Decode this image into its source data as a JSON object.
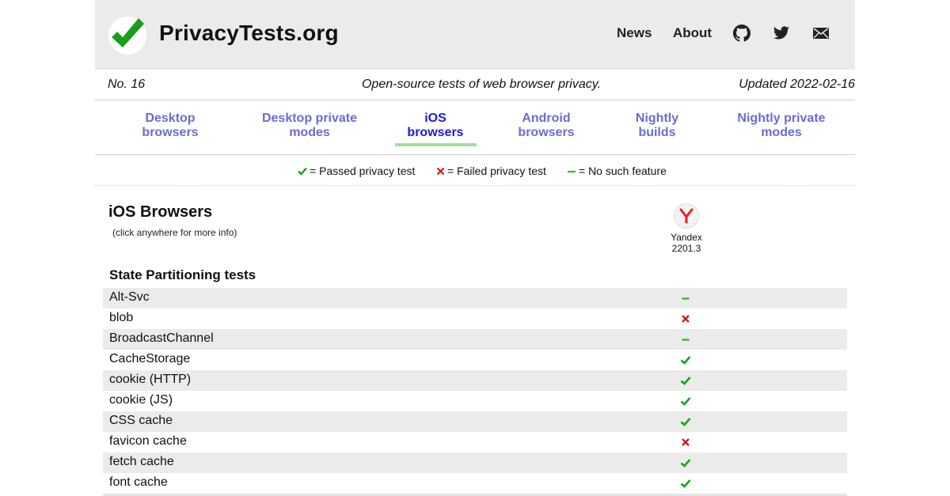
{
  "header": {
    "site_title": "PrivacyTests.org",
    "logo_icon": "checkmark-icon",
    "nav": {
      "news": "News",
      "about": "About"
    },
    "icons": [
      "github-icon",
      "twitter-icon",
      "mail-icon"
    ]
  },
  "subheader": {
    "issue": "No. 16",
    "tagline": "Open-source tests of web browser privacy.",
    "updated": "Updated 2022-02-16"
  },
  "tabs": [
    {
      "line1": "Desktop",
      "line2": "browsers",
      "active": false
    },
    {
      "line1": "Desktop private",
      "line2": "modes",
      "active": false
    },
    {
      "line1": "iOS",
      "line2": "browsers",
      "active": true
    },
    {
      "line1": "Android",
      "line2": "browsers",
      "active": false
    },
    {
      "line1": "Nightly",
      "line2": "builds",
      "active": false
    },
    {
      "line1": "Nightly private",
      "line2": "modes",
      "active": false
    }
  ],
  "legend": {
    "passed": "= Passed privacy test",
    "failed": "= Failed privacy test",
    "none": "= No such feature"
  },
  "colors": {
    "pass": "#1aa31a",
    "fail": "#d11a1a",
    "none": "#2bbf2b",
    "tab": "#6b6bd6",
    "tab_active": "#1a1ad6",
    "active_underline": "#9be29b",
    "header_bg": "#ebebeb"
  },
  "main": {
    "title": "iOS Browsers",
    "note": "(click anywhere for more info)",
    "browser": {
      "name": "Yandex",
      "version": "2201.3",
      "icon": "yandex-logo-icon"
    },
    "group_title": "State Partitioning tests",
    "rows": [
      {
        "label": "Alt-Svc",
        "result": "none"
      },
      {
        "label": "blob",
        "result": "fail"
      },
      {
        "label": "BroadcastChannel",
        "result": "none"
      },
      {
        "label": "CacheStorage",
        "result": "pass"
      },
      {
        "label": "cookie (HTTP)",
        "result": "pass"
      },
      {
        "label": "cookie (JS)",
        "result": "pass"
      },
      {
        "label": "CSS cache",
        "result": "pass"
      },
      {
        "label": "favicon cache",
        "result": "fail"
      },
      {
        "label": "fetch cache",
        "result": "pass"
      },
      {
        "label": "font cache",
        "result": "pass"
      }
    ]
  }
}
